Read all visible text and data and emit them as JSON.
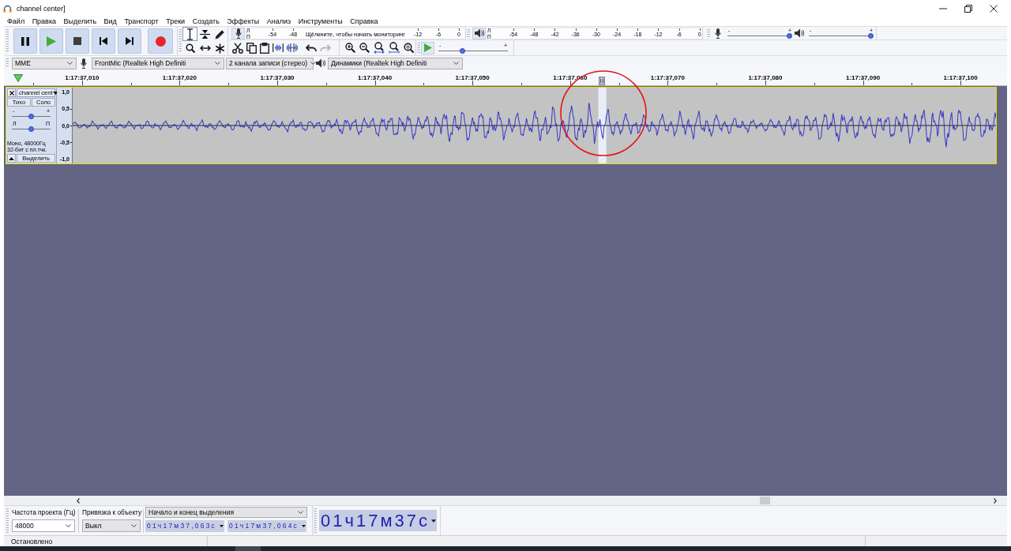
{
  "window": {
    "title": "channel center]"
  },
  "menu": [
    "Файл",
    "Правка",
    "Выделить",
    "Вид",
    "Транспорт",
    "Треки",
    "Создать",
    "Эффекты",
    "Анализ",
    "Инструменты",
    "Справка"
  ],
  "transport": [
    {
      "kind": "pause"
    },
    {
      "kind": "play"
    },
    {
      "kind": "stop"
    },
    {
      "kind": "skip_start"
    },
    {
      "kind": "skip_end"
    },
    {
      "kind": "record"
    }
  ],
  "tools": [
    {
      "kind": "select",
      "selected": true
    },
    {
      "kind": "envelope",
      "selected": false
    },
    {
      "kind": "draw",
      "selected": false
    },
    {
      "kind": "zoom",
      "selected": false
    },
    {
      "kind": "time_shift",
      "selected": false
    },
    {
      "kind": "multi",
      "selected": false
    }
  ],
  "recording_meter": {
    "channels": [
      "Л",
      "П"
    ],
    "scale": [
      {
        "kind": "tick",
        "label": "-54"
      },
      {
        "kind": "tick",
        "label": "-48"
      },
      {
        "kind": "prompt",
        "label": "Щёлкните, чтобы начать мониторинг"
      },
      {
        "kind": "tick",
        "label": "-12"
      },
      {
        "kind": "tick",
        "label": "-6"
      },
      {
        "kind": "tick",
        "label": "0"
      }
    ]
  },
  "playback_meter": {
    "channels": [
      "Л",
      "П"
    ],
    "scale": [
      "-54",
      "-48",
      "-42",
      "-36",
      "-30",
      "-24",
      "-18",
      "-12",
      "-6",
      "0"
    ]
  },
  "mixer": {
    "recording_volume": {
      "min_label": "-",
      "max_label": "+",
      "level": 1
    },
    "playback_volume": {
      "min_label": "-",
      "max_label": "+",
      "level": 1
    }
  },
  "edit_tools": [
    {
      "kind": "cut",
      "disabled": false
    },
    {
      "kind": "copy",
      "disabled": false
    },
    {
      "kind": "paste",
      "disabled": false
    },
    {
      "kind": "trim",
      "disabled": false
    },
    {
      "kind": "silence",
      "disabled": false
    },
    {
      "kind": "undo",
      "disabled": false
    },
    {
      "kind": "redo",
      "disabled": true
    }
  ],
  "zoom_tools": [
    {
      "kind": "zoom_in"
    },
    {
      "kind": "zoom_out"
    },
    {
      "kind": "fit_selection"
    },
    {
      "kind": "fit_project"
    },
    {
      "kind": "zoom_toggle"
    }
  ],
  "play_at_speed": {
    "min_label": "-",
    "max_label": "+",
    "level": 0.33
  },
  "devices": {
    "host": "MME",
    "recording_device": "FrontMic (Realtek High Definiti",
    "recording_channels": "2 канала записи (стерео)",
    "playback_device": "Динамики (Realtek High Definiti"
  },
  "ruler": {
    "labels": [
      "1:17:37,010",
      "1:17:37,020",
      "1:17:37,030",
      "1:17:37,040",
      "1:17:37,050",
      "1:17:37,060",
      "1:17:37,070",
      "1:17:37,080",
      "1:17:37,090",
      "1:17:37,100"
    ]
  },
  "track": {
    "name": "channel cent",
    "focused": true,
    "mute": "Тихо",
    "solo": "Соло",
    "gain": {
      "min_label": "-",
      "max_label": "+",
      "level": 0.5
    },
    "pan": {
      "min_label": "Л",
      "max_label": "П",
      "level": 0.5
    },
    "info": [
      "Моно, 48000Гц",
      "32-бит с пл.тчк."
    ],
    "select_label": "Выделить",
    "scale": [
      "1,0",
      "0,5",
      "0,0",
      "-0,5",
      "-1,0"
    ]
  },
  "selection_toolbar": {
    "rate_label": "Частота проекта (Гц)",
    "rate": "48000",
    "snap_label": "Привязка к объекту",
    "snap": "Выкл",
    "mode": "Начало и конец выделения",
    "start": "01ч17м37,063с",
    "end": "01ч17м37,064с"
  },
  "time_toolbar": {
    "time": "01ч17м37с"
  },
  "status_bar": {
    "text": "Остановлено"
  }
}
